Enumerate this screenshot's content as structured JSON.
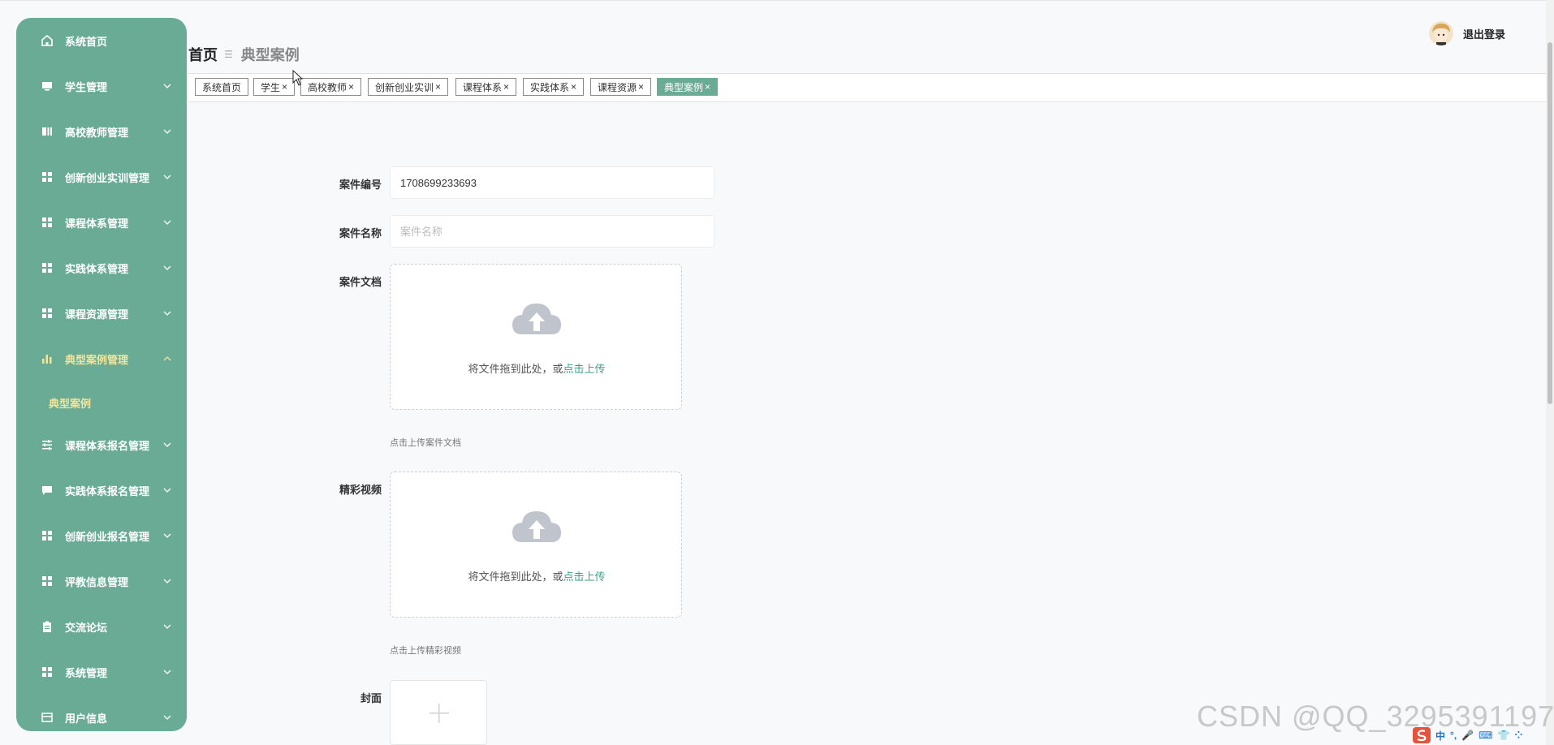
{
  "colors": {
    "accent": "#6aab96",
    "active_menu_text": "#f4e59a",
    "link": "#3aa28a"
  },
  "sidebar": {
    "items": [
      {
        "label": "系统首页",
        "icon": "home-icon"
      },
      {
        "label": "学生管理",
        "icon": "monitor-icon"
      },
      {
        "label": "高校教师管理",
        "icon": "columns-icon"
      },
      {
        "label": "创新创业实训管理",
        "icon": "grid-icon"
      },
      {
        "label": "课程体系管理",
        "icon": "grid-icon"
      },
      {
        "label": "实践体系管理",
        "icon": "grid-icon"
      },
      {
        "label": "课程资源管理",
        "icon": "grid-icon"
      },
      {
        "label": "典型案例管理",
        "icon": "bar-chart-icon"
      },
      {
        "label": "课程体系报名管理",
        "icon": "sliders-icon"
      },
      {
        "label": "实践体系报名管理",
        "icon": "chat-icon"
      },
      {
        "label": "创新创业报名管理",
        "icon": "grid-icon"
      },
      {
        "label": "评教信息管理",
        "icon": "grid-icon"
      },
      {
        "label": "交流论坛",
        "icon": "clipboard-icon"
      },
      {
        "label": "系统管理",
        "icon": "grid-icon"
      },
      {
        "label": "用户信息",
        "icon": "card-icon"
      }
    ],
    "submenu": {
      "label": "典型案例"
    }
  },
  "header": {
    "breadcrumb_home": "首页",
    "breadcrumb_current": "典型案例",
    "logout_label": "退出登录"
  },
  "tags": [
    {
      "label": "系统首页",
      "closable": false
    },
    {
      "label": "学生",
      "closable": true
    },
    {
      "label": "高校教师",
      "closable": true
    },
    {
      "label": "创新创业实训",
      "closable": true
    },
    {
      "label": "课程体系",
      "closable": true
    },
    {
      "label": "实践体系",
      "closable": true
    },
    {
      "label": "课程资源",
      "closable": true
    },
    {
      "label": "典型案例",
      "closable": true,
      "active": true
    }
  ],
  "form": {
    "case_no_label": "案件编号",
    "case_no_value": "1708699233693",
    "case_name_label": "案件名称",
    "case_name_placeholder": "案件名称",
    "case_doc_label": "案件文档",
    "upload_text": "将文件拖到此处，或",
    "upload_link": "点击上传",
    "case_doc_hint": "点击上传案件文档",
    "video_label": "精彩视频",
    "video_hint": "点击上传精彩视频",
    "cover_label": "封面"
  },
  "watermark": "CSDN @QQ_3295391197",
  "ime": [
    "中",
    "°,",
    "🎤",
    "⌨",
    "👕",
    "⁘"
  ]
}
